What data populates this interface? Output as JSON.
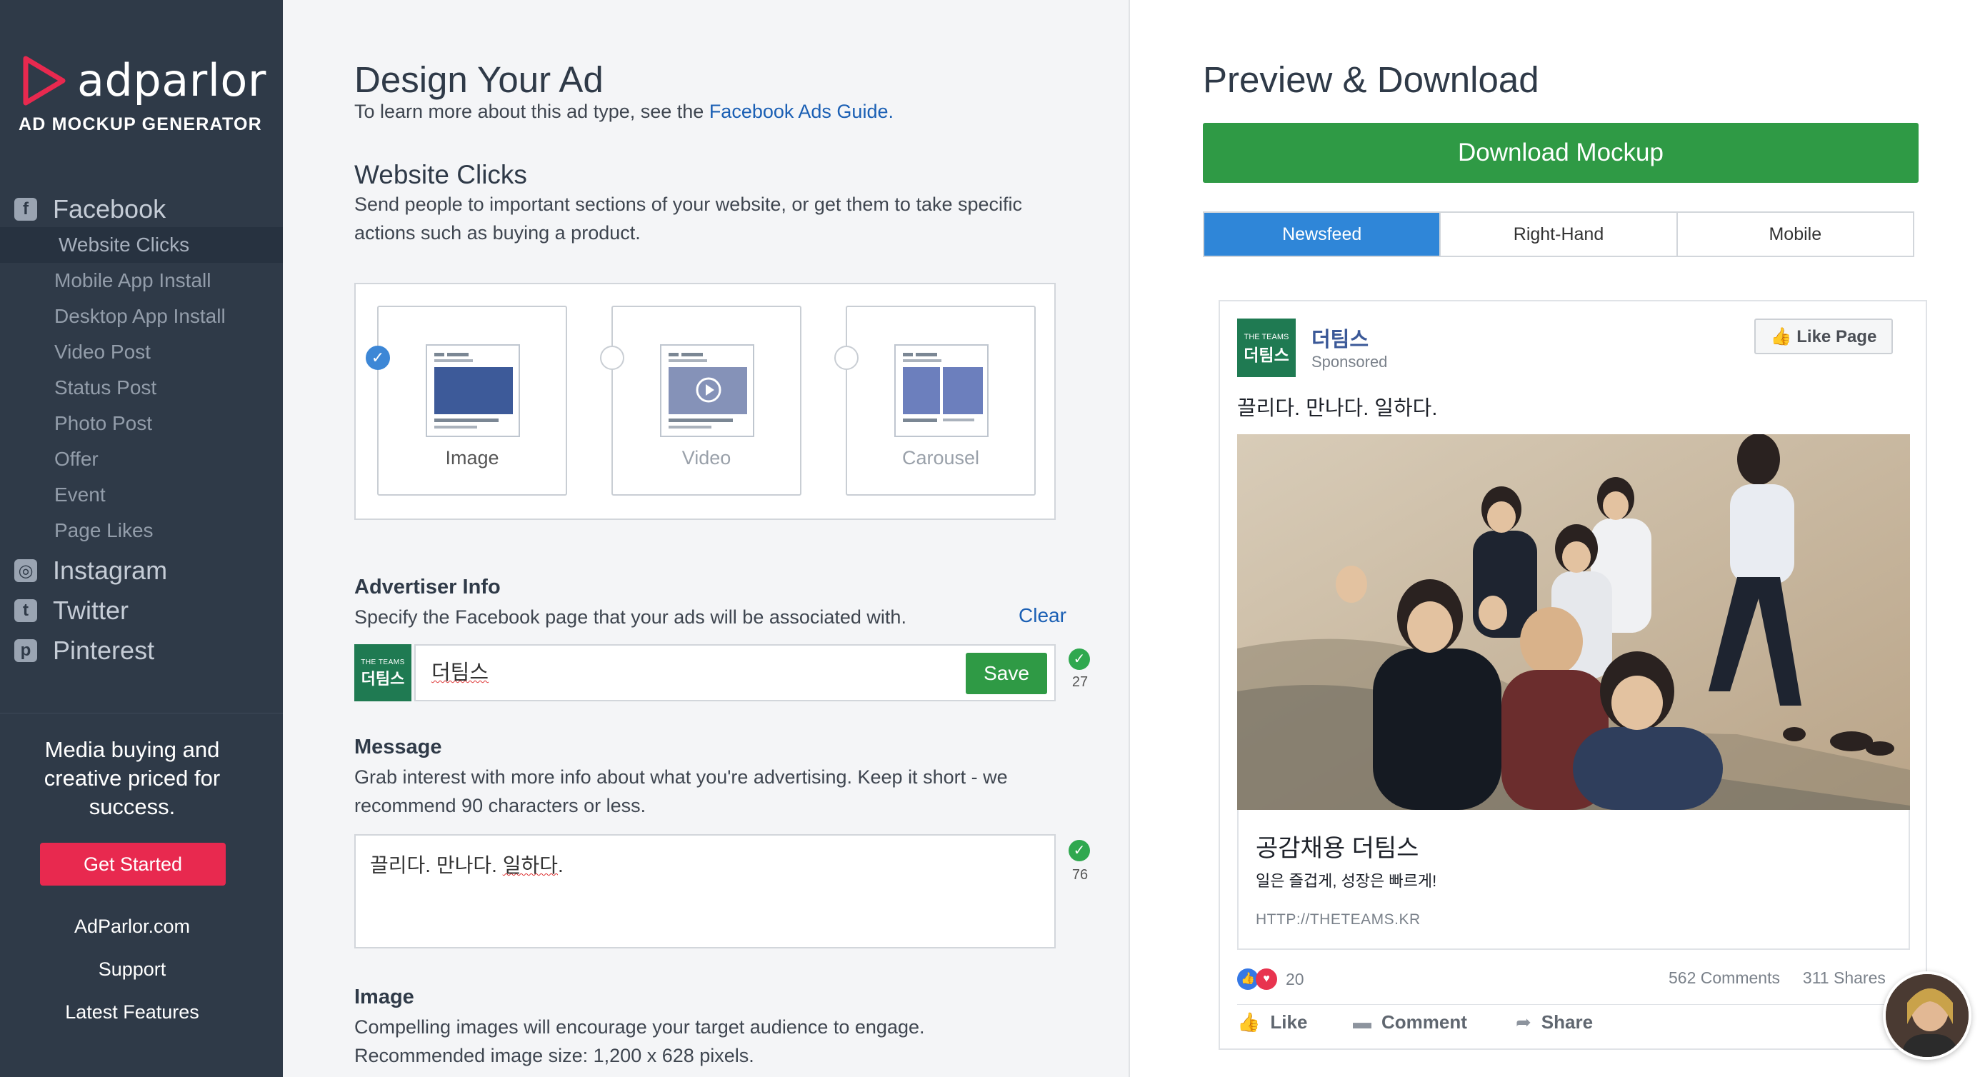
{
  "brand": {
    "name": "adparlor",
    "subtitle": "AD MOCKUP GENERATOR",
    "accent": "#e8294f"
  },
  "sidebar": {
    "facebook": {
      "label": "Facebook",
      "items": [
        "Website Clicks",
        "Mobile App Install",
        "Desktop App Install",
        "Video Post",
        "Status Post",
        "Photo Post",
        "Offer",
        "Event",
        "Page Likes"
      ],
      "active_index": 0
    },
    "platforms": [
      "Instagram",
      "Twitter",
      "Pinterest"
    ],
    "promo_line1": "Media buying and",
    "promo_line2": "creative priced for",
    "promo_line3": "success.",
    "cta": "Get Started",
    "links": [
      "AdParlor.com",
      "Support",
      "Latest Features"
    ]
  },
  "design": {
    "title": "Design Your Ad",
    "intro": "To learn more about this ad type, see the ",
    "intro_link": "Facebook Ads Guide.",
    "ad_type_title": "Website Clicks",
    "ad_type_desc1": "Send people to important sections of your website, or get them to take specific",
    "ad_type_desc2": "actions such as buying a product.",
    "formats": [
      {
        "label": "Image",
        "selected": true
      },
      {
        "label": "Video",
        "selected": false
      },
      {
        "label": "Carousel",
        "selected": false
      }
    ],
    "advertiser": {
      "title": "Advertiser Info",
      "desc": "Specify the Facebook page that your ads will be associated with.",
      "clear": "Clear",
      "logo_small": "THE TEAMS",
      "logo_big": "더팀스",
      "value": "더팀스",
      "save": "Save",
      "remaining": "27"
    },
    "message": {
      "title": "Message",
      "desc1": "Grab interest with more info about what you're advertising. Keep it short - we",
      "desc2": "recommend 90 characters or less.",
      "value_a": "끌리다. 만나다. ",
      "value_b": "일하다",
      "value_c": ".",
      "remaining": "76"
    },
    "image": {
      "title": "Image",
      "desc1": "Compelling images will encourage your target audience to engage.",
      "desc2": "Recommended image size: 1,200 x 628 pixels."
    }
  },
  "preview": {
    "title": "Preview & Download",
    "download": "Download Mockup",
    "tabs": [
      "Newsfeed",
      "Right-Hand",
      "Mobile"
    ],
    "active_tab": 0,
    "post": {
      "page_name": "더팀스",
      "sponsored": "Sponsored",
      "like_page": "Like Page",
      "message": "끌리다. 만나다. 일하다.",
      "headline": "공감채용 더팀스",
      "description": "일은 즐겁게, 성장은 빠르게!",
      "url": "HTTP://THETEAMS.KR",
      "reactions": "20",
      "comments": "562 Comments",
      "shares": "311 Shares",
      "actions": [
        "Like",
        "Comment",
        "Share"
      ]
    }
  },
  "colors": {
    "sidebar": "#2f3a48",
    "green": "#2f9a45",
    "blue": "#2f86d8",
    "fb_blue": "#3b5998"
  }
}
